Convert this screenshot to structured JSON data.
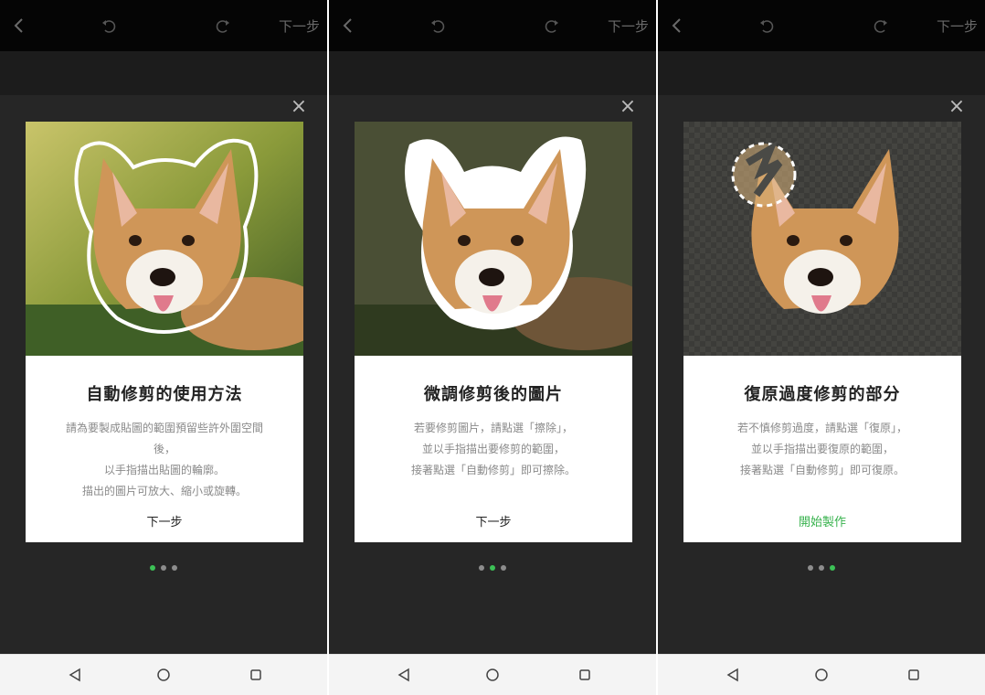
{
  "screens": [
    {
      "topbar": {
        "next_label": "下一步"
      },
      "card": {
        "title": "自動修剪的使用方法",
        "lines": [
          "請為要製成貼圖的範圍預留些許外圍空間",
          "後，",
          "以手指描出貼圖的輪廓。",
          "描出的圖片可放大、縮小或旋轉。"
        ],
        "action": "下一步"
      },
      "active_dot": 0
    },
    {
      "topbar": {
        "next_label": "下一步"
      },
      "card": {
        "title": "微調修剪後的圖片",
        "lines": [
          "若要修剪圖片，請點選「擦除」，",
          "並以手指描出要修剪的範圍，",
          "接著點選「自動修剪」即可擦除。"
        ],
        "action": "下一步"
      },
      "active_dot": 1
    },
    {
      "topbar": {
        "next_label": "下一步"
      },
      "card": {
        "title": "復原過度修剪的部分",
        "lines": [
          "若不慎修剪過度，請點選「復原」，",
          "並以手指描出要復原的範圍，",
          "接著點選「自動修剪」即可復原。"
        ],
        "action": "開始製作"
      },
      "active_dot": 2
    }
  ],
  "icons": {
    "back": "chevron-left-icon",
    "undo": "undo-icon",
    "redo": "redo-icon",
    "close": "close-icon",
    "nav_back": "triangle-back-icon",
    "nav_home": "circle-home-icon",
    "nav_recent": "square-recent-icon"
  },
  "colors": {
    "accent_green": "#3cc156",
    "action_green": "#37b24d"
  }
}
